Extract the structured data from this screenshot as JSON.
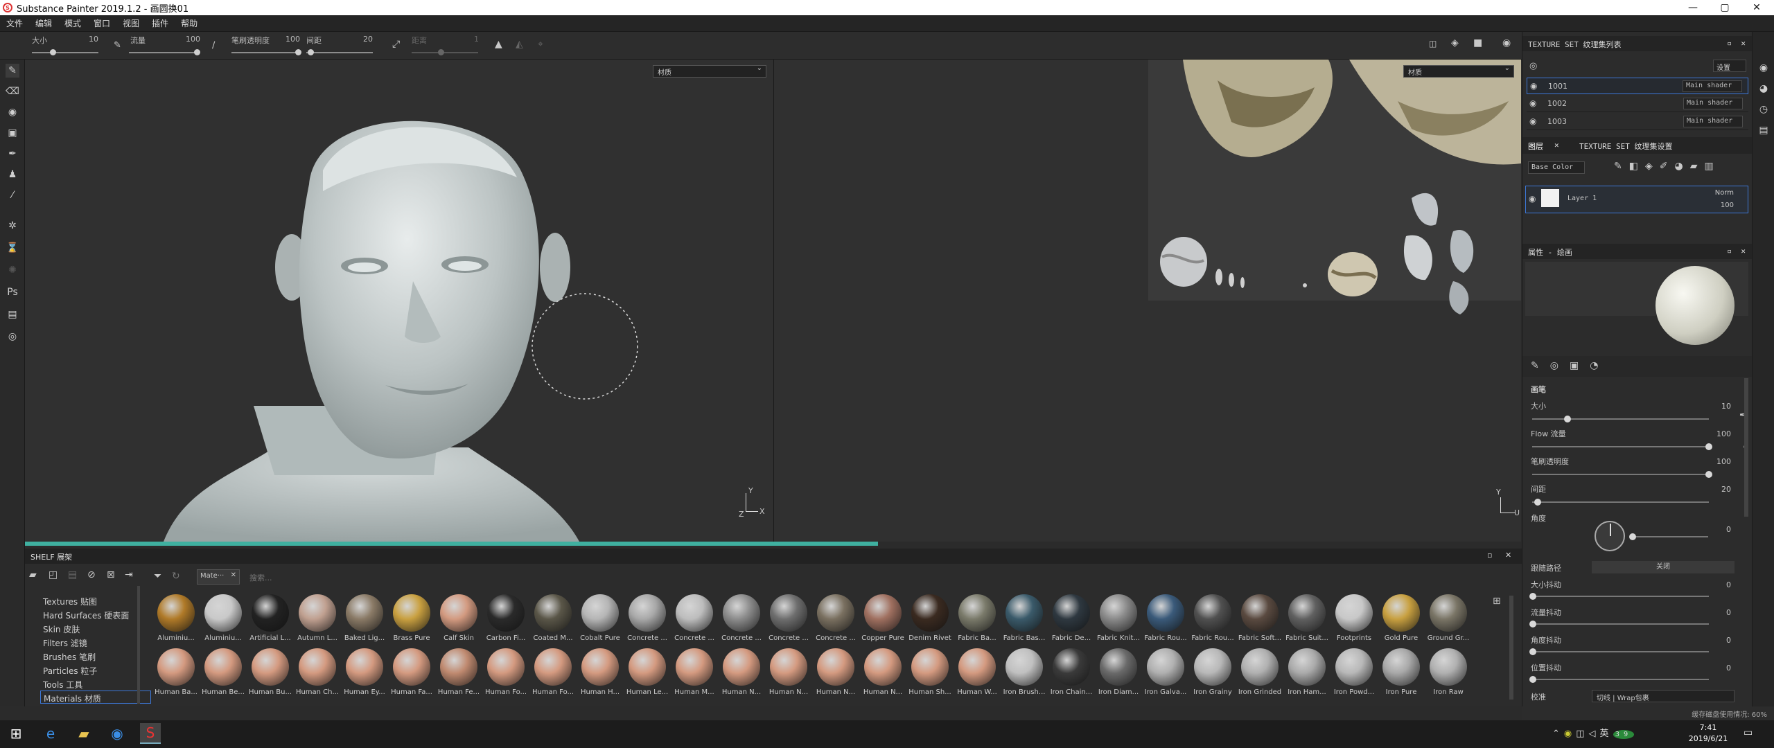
{
  "window": {
    "title": "Substance Painter 2019.1.2 - 画圆换01",
    "minimize": "—",
    "maximize": "▢",
    "close": "✕"
  },
  "menu": [
    "文件",
    "编辑",
    "模式",
    "窗口",
    "视图",
    "插件",
    "帮助"
  ],
  "toolbar": {
    "size_label": "大小",
    "size_value": "10",
    "flow_label": "流量",
    "flow_value": "100",
    "opacity_label": "笔刷透明度",
    "opacity_value": "100",
    "spacing_label": "间距",
    "spacing_value": "20",
    "distance_label": "距离",
    "distance_value": "1"
  },
  "viewport3d": {
    "dropdown": "材质",
    "axis_y": "Y",
    "axis_z": "Z",
    "axis_x": "X"
  },
  "viewport2d": {
    "dropdown": "材质",
    "axis_y": "Y",
    "axis_u": "U"
  },
  "progress": 0.57,
  "shelf": {
    "title": "SHELF 展架",
    "filter_tag": "Mate···",
    "search_placeholder": "搜索...",
    "categories": [
      "Textures 贴图",
      "Hard Surfaces 硬表面",
      "Skin 皮肤",
      "Filters 滤镜",
      "Brushes 笔刷",
      "Particles 粒子",
      "Tools 工具",
      "Materials 材质"
    ],
    "row1": [
      "Aluminiu...",
      "Aluminiu...",
      "Artificial L...",
      "Autumn L...",
      "Baked Lig...",
      "Brass Pure",
      "Calf Skin",
      "Carbon Fi...",
      "Coated M...",
      "Cobalt Pure",
      "Concrete ...",
      "Concrete ...",
      "Concrete ...",
      "Concrete ...",
      "Concrete ...",
      "Copper Pure",
      "Denim Rivet",
      "Fabric Ba...",
      "Fabric Bas...",
      "Fabric De...",
      "Fabric Knit...",
      "Fabric Rou...",
      "Fabric Rou...",
      "Fabric Soft...",
      "Fabric Suit...",
      "Footprints",
      "Gold Pure",
      "Ground Gr..."
    ],
    "row2": [
      "Human Ba...",
      "Human Be...",
      "Human Bu...",
      "Human Ch...",
      "Human Ey...",
      "Human Fa...",
      "Human Fe...",
      "Human Fo...",
      "Human Fo...",
      "Human H...",
      "Human Le...",
      "Human M...",
      "Human N...",
      "Human N...",
      "Human N...",
      "Human N...",
      "Human Sh...",
      "Human W...",
      "Iron Brush...",
      "Iron Chain...",
      "Iron Diam...",
      "Iron Galva...",
      "Iron Grainy",
      "Iron Grinded",
      "Iron Ham...",
      "Iron Powd...",
      "Iron Pure",
      "Iron Raw"
    ],
    "row1_colors": [
      "#b07a28",
      "#c9c9c9",
      "#222222",
      "#c0a090",
      "#8a7a66",
      "#c9a040",
      "#d39a80",
      "#2a2a2a",
      "#5a5648",
      "#b5b5b5",
      "#a8a8a8",
      "#bdbdbd",
      "#8c8c8c",
      "#6e6e6e",
      "#7a7060",
      "#a07060",
      "#3a2a20",
      "#7a7a6a",
      "#3a5a6a",
      "#2e3840",
      "#8a8a8a",
      "#3a5a7a",
      "#505050",
      "#5a4a40",
      "#606060",
      "#c8c8c8",
      "#c8a040",
      "#7a7566"
    ],
    "row2_colors": [
      "#d49a80",
      "#d49a80",
      "#d49a80",
      "#d49a80",
      "#d49a80",
      "#d49a80",
      "#c08a70",
      "#d49a80",
      "#d49a80",
      "#d49a80",
      "#d49a80",
      "#d49a80",
      "#d49a80",
      "#d49a80",
      "#d49a80",
      "#d49a80",
      "#d49a80",
      "#d49a80",
      "#c0c0c0",
      "#3a3a3a",
      "#6a6a6a",
      "#b0b0b0",
      "#b8b8b8",
      "#b0b0b0",
      "#aaaaaa",
      "#b8b8b8",
      "#a8a8a8",
      "#b0b0b0"
    ]
  },
  "texture_set_list": {
    "title": "TEXTURE SET 纹理集列表",
    "settings": "设置",
    "sets": [
      {
        "name": "1001",
        "shader": "Main shader"
      },
      {
        "name": "1002",
        "shader": "Main shader"
      },
      {
        "name": "1003",
        "shader": "Main shader"
      }
    ]
  },
  "layers": {
    "tab_layers": "图层",
    "tab_settings": "TEXTURE SET 纹理集设置",
    "channel": "Base Color",
    "layer_name": "Layer 1",
    "blend": "Norm",
    "opacity": "100"
  },
  "properties": {
    "title": "属性 - 绘画",
    "section": "画笔",
    "size_label": "大小",
    "size_value": "10",
    "size_level": 0.2,
    "flow_label": "Flow 流量",
    "flow_value": "100",
    "flow_level": 1.0,
    "opacity_label": "笔刷透明度",
    "opacity_value": "100",
    "opacity_level": 1.0,
    "spacing_label": "间距",
    "spacing_value": "20",
    "spacing_level": 0.03,
    "angle_label": "角度",
    "angle_value": "0",
    "follow_path_label": "跟随路径",
    "follow_path_value": "关闭",
    "size_jitter_label": "大小抖动",
    "size_jitter_value": "0",
    "flow_jitter_label": "流量抖动",
    "flow_jitter_value": "0",
    "angle_jitter_label": "角度抖动",
    "angle_jitter_value": "0",
    "pos_jitter_label": "位置抖动",
    "pos_jitter_value": "0",
    "alignment_label": "校准",
    "alignment_value": "切线 | Wrap包裹"
  },
  "status": {
    "vram": "缓存磁盘使用情况: 60%"
  },
  "taskbar": {
    "time": "7:41",
    "date": "2019/6/21",
    "ime": "英",
    "badge": "39"
  }
}
